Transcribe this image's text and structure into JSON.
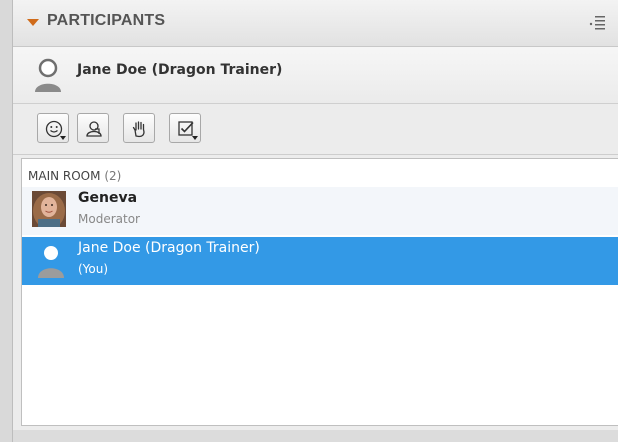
{
  "panel": {
    "title": "PARTICIPANTS",
    "menu_icon": "panel-menu-icon"
  },
  "current_user": {
    "name": "Jane Doe (Dragon Trainer)",
    "icon": "user-silhouette-icon"
  },
  "toolbar": {
    "buttons": [
      {
        "name": "status-button",
        "icon": "smiley-icon"
      },
      {
        "name": "role-button",
        "icon": "user-role-icon"
      },
      {
        "name": "raise-hand-button",
        "icon": "hand-icon"
      },
      {
        "name": "agree-button",
        "icon": "checkbox-icon"
      }
    ]
  },
  "room": {
    "label": "MAIN ROOM",
    "count": "(2)"
  },
  "participants": [
    {
      "name": "Geneva",
      "role": "Moderator",
      "selected": false
    },
    {
      "name": "Jane Doe (Dragon Trainer)",
      "role": "(You)",
      "selected": true
    }
  ],
  "colors": {
    "accent_orange": "#d06b1a",
    "selection_blue": "#3399e6"
  }
}
